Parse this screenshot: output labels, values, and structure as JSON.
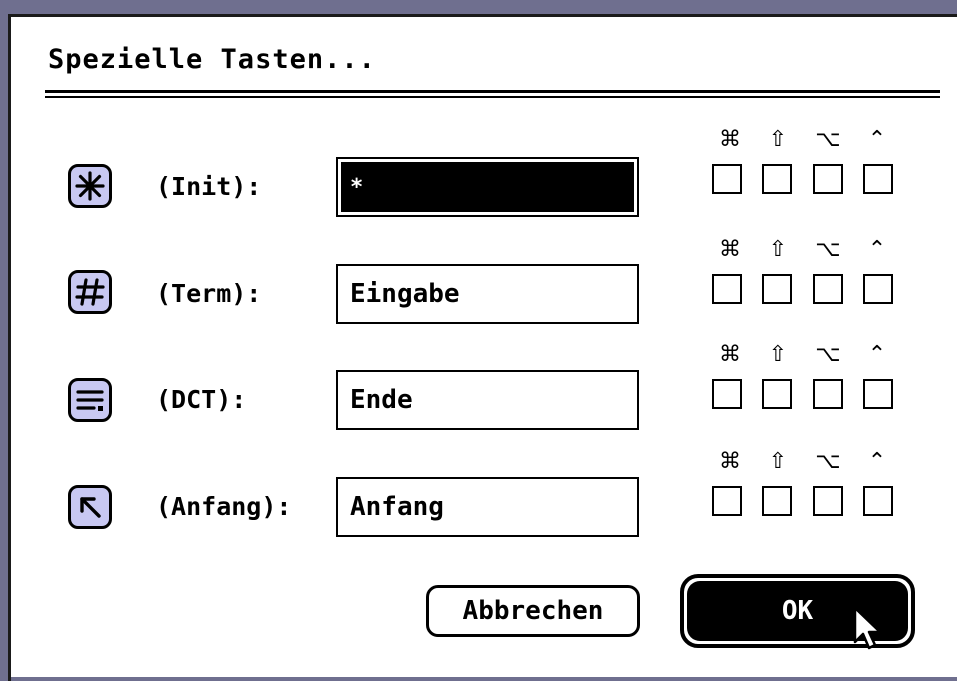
{
  "dialog": {
    "title": "Spezielle Tasten..."
  },
  "rows": [
    {
      "icon": "asterisk-key-icon",
      "label": "(Init):",
      "value": "*",
      "selected": true
    },
    {
      "icon": "hash-key-icon",
      "label": "(Term):",
      "value": "Eingabe",
      "selected": false
    },
    {
      "icon": "dct-key-icon",
      "label": "(DCT):",
      "value": "Ende",
      "selected": false
    },
    {
      "icon": "arrow-up-left-key-icon",
      "label": "(Anfang):",
      "value": "Anfang",
      "selected": false
    }
  ],
  "modifiers": {
    "command": "⌘",
    "shift": "⇧",
    "option": "⌥",
    "control": "⌃"
  },
  "buttons": {
    "cancel": "Abbrechen",
    "ok": "OK"
  },
  "colors": {
    "key_icon_fill": "#c8c8f2",
    "window_frame": "#6f6f8f"
  }
}
